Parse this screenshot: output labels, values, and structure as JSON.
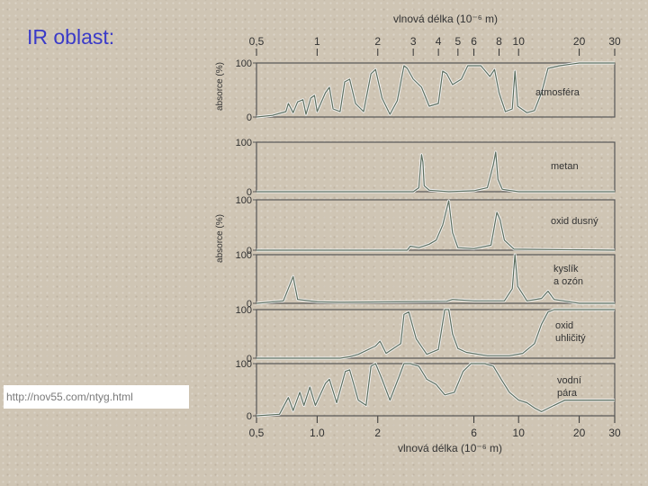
{
  "slide": {
    "title": "IR oblast:",
    "source_url": "http://nov55.com/ntyg.html"
  },
  "chart_data": {
    "type": "line",
    "x_scale": "log",
    "xlim": [
      0.5,
      30
    ],
    "ylim": [
      0,
      100
    ],
    "top_xlabel": "vlnová délka (10⁻⁶ m)",
    "bottom_xlabel": "vlnová délka (10⁻⁶ m)",
    "top_ticks": [
      "0,5",
      "1",
      "2",
      "3",
      "4",
      "5",
      "6",
      "8",
      "10",
      "20",
      "30"
    ],
    "top_tick_values": [
      0.5,
      1,
      2,
      3,
      4,
      5,
      6,
      8,
      10,
      20,
      30
    ],
    "bottom_ticks": [
      "0,5",
      "1.0",
      "2",
      "6",
      "10",
      "20",
      "30"
    ],
    "bottom_tick_values": [
      0.5,
      1,
      2,
      6,
      10,
      20,
      30
    ],
    "ylabel_top": "absorce (%)",
    "ylabel_lower": "absorce (%)",
    "y_tick_labels": [
      "100",
      "0"
    ],
    "series": [
      {
        "name": "atmosféra",
        "points": [
          [
            0.5,
            0
          ],
          [
            0.6,
            3
          ],
          [
            0.7,
            10
          ],
          [
            0.72,
            25
          ],
          [
            0.76,
            8
          ],
          [
            0.8,
            28
          ],
          [
            0.85,
            32
          ],
          [
            0.88,
            5
          ],
          [
            0.93,
            35
          ],
          [
            0.97,
            40
          ],
          [
            1.0,
            10
          ],
          [
            1.1,
            45
          ],
          [
            1.15,
            55
          ],
          [
            1.2,
            15
          ],
          [
            1.3,
            10
          ],
          [
            1.37,
            65
          ],
          [
            1.45,
            70
          ],
          [
            1.55,
            25
          ],
          [
            1.7,
            10
          ],
          [
            1.85,
            80
          ],
          [
            1.95,
            88
          ],
          [
            2.1,
            35
          ],
          [
            2.3,
            5
          ],
          [
            2.5,
            30
          ],
          [
            2.7,
            95
          ],
          [
            2.8,
            90
          ],
          [
            3.0,
            70
          ],
          [
            3.3,
            55
          ],
          [
            3.6,
            20
          ],
          [
            4.0,
            25
          ],
          [
            4.2,
            85
          ],
          [
            4.4,
            80
          ],
          [
            4.7,
            60
          ],
          [
            5.2,
            70
          ],
          [
            5.6,
            95
          ],
          [
            6.5,
            95
          ],
          [
            7.2,
            75
          ],
          [
            7.6,
            88
          ],
          [
            8.0,
            45
          ],
          [
            8.6,
            10
          ],
          [
            9.3,
            15
          ],
          [
            9.6,
            85
          ],
          [
            9.9,
            20
          ],
          [
            11,
            8
          ],
          [
            12,
            12
          ],
          [
            13,
            45
          ],
          [
            14,
            90
          ],
          [
            16,
            95
          ],
          [
            20,
            100
          ],
          [
            30,
            100
          ]
        ]
      },
      {
        "name": "metan",
        "points": [
          [
            0.5,
            0
          ],
          [
            3.0,
            0
          ],
          [
            3.2,
            8
          ],
          [
            3.3,
            75
          ],
          [
            3.35,
            60
          ],
          [
            3.4,
            12
          ],
          [
            3.6,
            3
          ],
          [
            4.5,
            0
          ],
          [
            6.0,
            2
          ],
          [
            7.0,
            8
          ],
          [
            7.5,
            55
          ],
          [
            7.7,
            80
          ],
          [
            7.9,
            25
          ],
          [
            8.3,
            5
          ],
          [
            10,
            0
          ],
          [
            30,
            0
          ]
        ]
      },
      {
        "name": "oxid dusný",
        "points": [
          [
            0.5,
            0
          ],
          [
            2.8,
            0
          ],
          [
            2.9,
            8
          ],
          [
            3.2,
            5
          ],
          [
            3.6,
            12
          ],
          [
            3.9,
            20
          ],
          [
            4.2,
            50
          ],
          [
            4.5,
            98
          ],
          [
            4.7,
            35
          ],
          [
            5.0,
            5
          ],
          [
            6,
            3
          ],
          [
            7.3,
            10
          ],
          [
            7.8,
            75
          ],
          [
            8.1,
            60
          ],
          [
            8.5,
            20
          ],
          [
            9.5,
            2
          ],
          [
            30,
            0
          ]
        ]
      },
      {
        "name": "kyslík a ozón",
        "points": [
          [
            0.5,
            0
          ],
          [
            0.68,
            5
          ],
          [
            0.76,
            55
          ],
          [
            0.8,
            8
          ],
          [
            1.0,
            3
          ],
          [
            1.27,
            2
          ],
          [
            2.5,
            3
          ],
          [
            4.4,
            4
          ],
          [
            4.7,
            8
          ],
          [
            6,
            5
          ],
          [
            8.5,
            5
          ],
          [
            9.3,
            30
          ],
          [
            9.6,
            100
          ],
          [
            9.9,
            35
          ],
          [
            11,
            5
          ],
          [
            13,
            10
          ],
          [
            14,
            25
          ],
          [
            15,
            8
          ],
          [
            20,
            0
          ],
          [
            30,
            0
          ]
        ]
      },
      {
        "name": "oxid uhličitý",
        "points": [
          [
            0.5,
            0
          ],
          [
            1.3,
            0
          ],
          [
            1.45,
            3
          ],
          [
            1.6,
            8
          ],
          [
            1.95,
            25
          ],
          [
            2.05,
            35
          ],
          [
            2.2,
            10
          ],
          [
            2.6,
            30
          ],
          [
            2.7,
            90
          ],
          [
            2.85,
            95
          ],
          [
            3.1,
            40
          ],
          [
            3.5,
            8
          ],
          [
            4.0,
            18
          ],
          [
            4.3,
            100
          ],
          [
            4.5,
            100
          ],
          [
            4.7,
            50
          ],
          [
            5.0,
            20
          ],
          [
            5.5,
            12
          ],
          [
            7,
            5
          ],
          [
            9,
            5
          ],
          [
            10.5,
            10
          ],
          [
            12,
            30
          ],
          [
            13,
            70
          ],
          [
            14,
            95
          ],
          [
            15,
            100
          ],
          [
            20,
            100
          ],
          [
            30,
            100
          ]
        ]
      },
      {
        "name": "vodní pára",
        "points": [
          [
            0.5,
            0
          ],
          [
            0.65,
            3
          ],
          [
            0.72,
            35
          ],
          [
            0.76,
            10
          ],
          [
            0.82,
            45
          ],
          [
            0.86,
            20
          ],
          [
            0.92,
            55
          ],
          [
            0.98,
            20
          ],
          [
            1.1,
            62
          ],
          [
            1.15,
            70
          ],
          [
            1.25,
            25
          ],
          [
            1.38,
            85
          ],
          [
            1.45,
            88
          ],
          [
            1.6,
            30
          ],
          [
            1.75,
            20
          ],
          [
            1.85,
            95
          ],
          [
            1.95,
            100
          ],
          [
            2.1,
            70
          ],
          [
            2.3,
            30
          ],
          [
            2.55,
            75
          ],
          [
            2.7,
            100
          ],
          [
            2.9,
            100
          ],
          [
            3.2,
            95
          ],
          [
            3.5,
            70
          ],
          [
            3.9,
            60
          ],
          [
            4.3,
            40
          ],
          [
            4.8,
            45
          ],
          [
            5.3,
            85
          ],
          [
            5.8,
            100
          ],
          [
            6.8,
            100
          ],
          [
            7.5,
            95
          ],
          [
            8.2,
            70
          ],
          [
            9.0,
            45
          ],
          [
            10,
            30
          ],
          [
            11,
            25
          ],
          [
            12,
            15
          ],
          [
            13,
            8
          ],
          [
            15,
            20
          ],
          [
            17,
            30
          ],
          [
            30,
            30
          ]
        ]
      }
    ],
    "series_labels": [
      [
        "atmosféra"
      ],
      [
        "metan"
      ],
      [
        "oxid dusný"
      ],
      [
        "kyslík",
        "a ozón"
      ],
      [
        "oxid",
        "uhličitý"
      ],
      [
        "vodní",
        "pára"
      ]
    ]
  }
}
